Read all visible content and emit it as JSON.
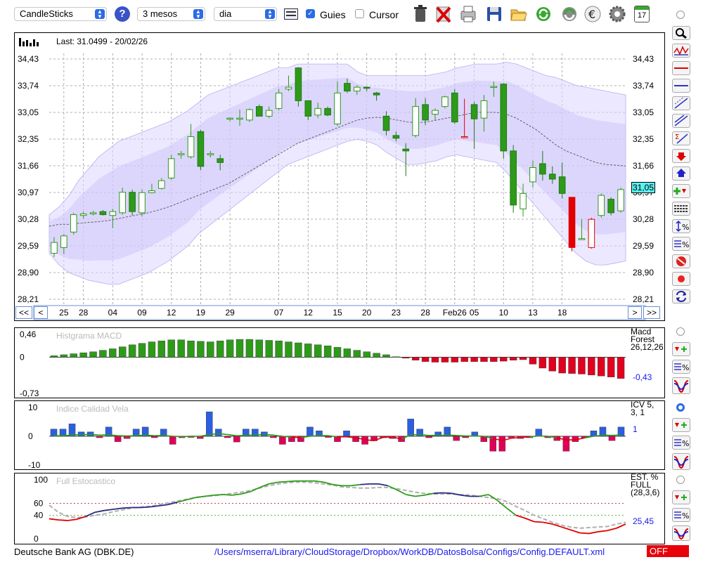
{
  "toolbar": {
    "chart_type": "CandleSticks",
    "help": "?",
    "period": "3 mesos",
    "interval": "dia",
    "guides_label": "Guies",
    "guides_checked": true,
    "cursor_label": "Cursor",
    "cursor_checked": false,
    "calendar_day": "17",
    "icons": [
      "chart-settings-icon",
      "trash-icon",
      "delete-icon",
      "print-icon",
      "save-icon",
      "open-folder-icon",
      "refresh-icon",
      "reload-icon",
      "euro-icon",
      "gear-icon",
      "calendar-icon"
    ]
  },
  "main_chart": {
    "last_label": "Last: 31.0499 - 20/02/26",
    "current_price": "31,05",
    "y_ticks": [
      "34,43",
      "33,74",
      "33,05",
      "32,35",
      "31,66",
      "30,97",
      "30,28",
      "29,59",
      "28,90",
      "28,21"
    ],
    "nav_prev_far": "<<",
    "nav_prev": "<",
    "nav_next": ">",
    "nav_next_far": ">>"
  },
  "chart_data": [
    {
      "type": "candlestick",
      "title": "",
      "ylim": [
        28.21,
        34.43
      ],
      "x_tick_labels": [
        "25",
        "28",
        "04",
        "09",
        "12",
        "19",
        "29",
        "07",
        "12",
        "15",
        "20",
        "23",
        "28",
        "Feb26",
        "05",
        "10",
        "13",
        "18"
      ],
      "x_tick_index": [
        1,
        3,
        6,
        9,
        12,
        15,
        18,
        23,
        26,
        29,
        32,
        35,
        38,
        41,
        43,
        46,
        49,
        52
      ],
      "candles": [
        {
          "o": 29.4,
          "h": 29.82,
          "l": 29.3,
          "c": 29.68
        },
        {
          "o": 29.55,
          "h": 29.9,
          "l": 29.38,
          "c": 29.85
        },
        {
          "o": 29.95,
          "h": 30.45,
          "l": 29.88,
          "c": 30.4
        },
        {
          "o": 30.38,
          "h": 30.48,
          "l": 30.3,
          "c": 30.42
        },
        {
          "o": 30.42,
          "h": 30.5,
          "l": 30.38,
          "c": 30.45
        },
        {
          "o": 30.48,
          "h": 30.52,
          "l": 30.38,
          "c": 30.4
        },
        {
          "o": 30.38,
          "h": 30.55,
          "l": 30.05,
          "c": 30.48
        },
        {
          "o": 30.45,
          "h": 31.1,
          "l": 30.4,
          "c": 30.98
        },
        {
          "o": 30.98,
          "h": 31.05,
          "l": 30.38,
          "c": 30.48
        },
        {
          "o": 30.45,
          "h": 31.05,
          "l": 30.35,
          "c": 30.97
        },
        {
          "o": 30.97,
          "h": 31.2,
          "l": 30.95,
          "c": 31.02
        },
        {
          "o": 31.08,
          "h": 31.35,
          "l": 31.05,
          "c": 31.28
        },
        {
          "o": 31.35,
          "h": 31.95,
          "l": 31.3,
          "c": 31.85
        },
        {
          "o": 31.95,
          "h": 32.05,
          "l": 31.85,
          "c": 31.98
        },
        {
          "o": 31.9,
          "h": 32.75,
          "l": 31.85,
          "c": 32.42
        },
        {
          "o": 32.55,
          "h": 32.6,
          "l": 31.55,
          "c": 31.65
        },
        {
          "o": 31.95,
          "h": 32.05,
          "l": 31.88,
          "c": 31.98
        },
        {
          "o": 31.85,
          "h": 31.95,
          "l": 31.55,
          "c": 31.75
        },
        {
          "o": 32.88,
          "h": 32.92,
          "l": 32.82,
          "c": 32.9
        },
        {
          "o": 32.88,
          "h": 33.12,
          "l": 32.7,
          "c": 32.9
        },
        {
          "o": 32.85,
          "h": 33.15,
          "l": 32.8,
          "c": 33.12
        },
        {
          "o": 33.2,
          "h": 33.25,
          "l": 32.95,
          "c": 32.95
        },
        {
          "o": 32.95,
          "h": 33.2,
          "l": 32.9,
          "c": 33.1
        },
        {
          "o": 33.15,
          "h": 33.65,
          "l": 33.1,
          "c": 33.55
        },
        {
          "o": 33.65,
          "h": 34.0,
          "l": 33.6,
          "c": 33.7
        },
        {
          "o": 34.2,
          "h": 34.22,
          "l": 33.2,
          "c": 33.35
        },
        {
          "o": 33.35,
          "h": 33.35,
          "l": 32.85,
          "c": 32.95
        },
        {
          "o": 32.98,
          "h": 33.3,
          "l": 32.9,
          "c": 33.15
        },
        {
          "o": 33.15,
          "h": 33.2,
          "l": 32.95,
          "c": 32.98
        },
        {
          "o": 32.75,
          "h": 33.85,
          "l": 32.7,
          "c": 33.55
        },
        {
          "o": 33.8,
          "h": 33.92,
          "l": 33.55,
          "c": 33.6
        },
        {
          "o": 33.6,
          "h": 33.75,
          "l": 33.5,
          "c": 33.7
        },
        {
          "o": 33.7,
          "h": 33.72,
          "l": 33.6,
          "c": 33.68
        },
        {
          "o": 33.55,
          "h": 33.58,
          "l": 33.35,
          "c": 33.5
        },
        {
          "o": 32.95,
          "h": 33.08,
          "l": 32.45,
          "c": 32.58
        },
        {
          "o": 32.45,
          "h": 32.55,
          "l": 32.3,
          "c": 32.38
        },
        {
          "o": 32.1,
          "h": 32.25,
          "l": 31.4,
          "c": 32.05
        },
        {
          "o": 32.45,
          "h": 33.42,
          "l": 32.4,
          "c": 33.2
        },
        {
          "o": 33.25,
          "h": 33.42,
          "l": 32.72,
          "c": 32.85
        },
        {
          "o": 33.0,
          "h": 33.15,
          "l": 32.85,
          "c": 33.1
        },
        {
          "o": 33.2,
          "h": 33.48,
          "l": 33.15,
          "c": 33.45
        },
        {
          "o": 33.55,
          "h": 33.65,
          "l": 32.75,
          "c": 32.8
        },
        {
          "o": 32.42,
          "h": 33.4,
          "l": 32.38,
          "c": 32.4
        },
        {
          "o": 33.25,
          "h": 33.32,
          "l": 32.1,
          "c": 32.88
        },
        {
          "o": 32.9,
          "h": 33.5,
          "l": 32.55,
          "c": 33.35
        },
        {
          "o": 33.7,
          "h": 33.85,
          "l": 33.45,
          "c": 33.72
        },
        {
          "o": 33.78,
          "h": 33.8,
          "l": 31.85,
          "c": 32.05
        },
        {
          "o": 32.05,
          "h": 32.2,
          "l": 30.45,
          "c": 30.65
        },
        {
          "o": 30.55,
          "h": 31.2,
          "l": 30.35,
          "c": 30.95
        },
        {
          "o": 31.25,
          "h": 31.8,
          "l": 31.1,
          "c": 31.62
        },
        {
          "o": 31.72,
          "h": 32.05,
          "l": 31.28,
          "c": 31.45
        },
        {
          "o": 31.45,
          "h": 31.65,
          "l": 31.2,
          "c": 31.32
        },
        {
          "o": 31.38,
          "h": 31.75,
          "l": 30.82,
          "c": 30.95
        },
        {
          "o": 30.85,
          "h": 30.85,
          "l": 29.45,
          "c": 29.55
        },
        {
          "o": 29.78,
          "h": 30.28,
          "l": 29.75,
          "c": 29.78
        },
        {
          "o": 30.28,
          "h": 30.32,
          "l": 29.52,
          "c": 29.55
        },
        {
          "o": 30.38,
          "h": 30.95,
          "l": 30.32,
          "c": 30.9
        },
        {
          "o": 30.8,
          "h": 30.85,
          "l": 30.38,
          "c": 30.45
        },
        {
          "o": 30.5,
          "h": 31.1,
          "l": 30.45,
          "c": 31.05
        }
      ],
      "bollinger_upper": [
        30.4,
        30.6,
        30.9,
        31.3,
        31.6,
        31.9,
        32.1,
        32.3,
        32.4,
        32.5,
        32.6,
        32.7,
        32.8,
        32.95,
        33.1,
        33.3,
        33.5,
        33.6,
        33.7,
        33.8,
        33.9,
        34.0,
        34.1,
        34.2,
        34.2,
        34.3,
        34.3,
        34.3,
        34.3,
        34.3,
        34.3,
        34.1,
        34.0,
        34.0,
        34.0,
        34.0,
        34.0,
        34.0,
        34.0,
        34.05,
        34.1,
        34.2,
        34.25,
        34.3,
        34.3,
        34.3,
        34.35,
        34.3,
        34.2,
        34.1,
        34.0,
        33.95,
        33.85,
        33.75,
        33.7,
        33.65,
        33.6,
        33.55,
        33.5
      ],
      "bollinger_lower": [
        29.4,
        29.1,
        28.9,
        28.8,
        28.7,
        28.65,
        28.6,
        28.6,
        28.7,
        28.8,
        28.9,
        29.05,
        29.2,
        29.4,
        29.6,
        29.9,
        30.1,
        30.3,
        30.5,
        30.7,
        30.9,
        31.1,
        31.3,
        31.5,
        31.7,
        31.8,
        31.9,
        32.0,
        32.1,
        32.2,
        32.3,
        32.35,
        32.3,
        32.2,
        32.0,
        31.85,
        31.7,
        31.7,
        31.75,
        31.8,
        31.9,
        31.95,
        31.9,
        31.85,
        31.8,
        31.75,
        31.5,
        31.2,
        30.9,
        30.6,
        30.3,
        30.0,
        29.7,
        29.4,
        29.2,
        29.1,
        29.1,
        29.15,
        29.2
      ],
      "moving_average": [
        30.1,
        30.15,
        30.15,
        30.18,
        30.2,
        30.22,
        30.25,
        30.3,
        30.35,
        30.4,
        30.45,
        30.52,
        30.6,
        30.7,
        30.8,
        30.9,
        31.0,
        31.1,
        31.2,
        31.35,
        31.5,
        31.65,
        31.8,
        31.95,
        32.1,
        32.25,
        32.35,
        32.45,
        32.55,
        32.65,
        32.75,
        32.85,
        32.9,
        32.92,
        32.9,
        32.85,
        32.8,
        32.78,
        32.8,
        32.85,
        32.9,
        32.95,
        33.0,
        33.05,
        33.05,
        33.05,
        33.0,
        32.9,
        32.75,
        32.6,
        32.4,
        32.2,
        32.05,
        31.95,
        31.85,
        31.75,
        31.7,
        31.68,
        31.66
      ]
    },
    {
      "type": "bar",
      "title": "Histgrama MACD",
      "params_label": "Macd Forest 26,12,26",
      "current_value": "-0,43",
      "y_ticks": [
        "0,46",
        "0",
        "-0,73"
      ],
      "ylim": [
        -0.73,
        0.46
      ],
      "values": [
        0.03,
        0.05,
        0.07,
        0.09,
        0.11,
        0.14,
        0.17,
        0.21,
        0.25,
        0.28,
        0.31,
        0.33,
        0.35,
        0.35,
        0.33,
        0.32,
        0.31,
        0.33,
        0.35,
        0.36,
        0.36,
        0.35,
        0.34,
        0.33,
        0.31,
        0.29,
        0.27,
        0.25,
        0.23,
        0.2,
        0.17,
        0.14,
        0.11,
        0.08,
        0.05,
        0.01,
        -0.02,
        -0.06,
        -0.09,
        -0.1,
        -0.1,
        -0.1,
        -0.09,
        -0.09,
        -0.09,
        -0.09,
        -0.08,
        -0.06,
        -0.05,
        -0.14,
        -0.22,
        -0.28,
        -0.32,
        -0.33,
        -0.34,
        -0.36,
        -0.38,
        -0.4,
        -0.43
      ]
    },
    {
      "type": "bar",
      "title": "Indice Calidad Vela",
      "params_label": "ICV 5, 3, 1",
      "current_value": "1",
      "y_ticks": [
        "10",
        "0",
        "-10"
      ],
      "ylim": [
        -10,
        10
      ],
      "values": [
        2.5,
        2.5,
        4.3,
        1.5,
        1.5,
        -0.5,
        3.2,
        -1.9,
        -0.8,
        2.5,
        3.2,
        -0.5,
        2.5,
        -2.8,
        -0.5,
        -0.4,
        -0.8,
        8.5,
        2.5,
        -0.5,
        -2,
        2.5,
        2.5,
        1.5,
        -0.5,
        -2.8,
        -1.9,
        -1.9,
        3.2,
        1.9,
        -0.4,
        -1.9,
        1.9,
        -1.9,
        -2.8,
        -1.6,
        -0.5,
        -0.8,
        -1.9,
        6.0,
        2.5,
        -0.5,
        1.5,
        3.2,
        -1.5,
        -0.5,
        1.5,
        -1.9,
        -5.2,
        -5.2,
        -0.5,
        -0.8,
        -0.5,
        2.5,
        -0.5,
        -1.5,
        -5.2,
        -1.9,
        -0.5,
        1.9,
        3.2,
        -1.5,
        3.2
      ],
      "line": [
        0.2,
        0.2,
        0.4,
        0.6,
        0.6,
        0.4,
        0.5,
        0.2,
        0.1,
        0.2,
        0.4,
        0.2,
        0.3,
        0.0,
        -0.1,
        0.0,
        0.0,
        0.6,
        0.9,
        0.6,
        0.2,
        0.3,
        0.5,
        0.6,
        0.4,
        0.0,
        -0.3,
        -0.5,
        0.0,
        0.3,
        0.2,
        -0.2,
        -0.2,
        -0.5,
        -1.2,
        -1.5,
        -0.4,
        -0.2,
        -1.0,
        0.5,
        0.6,
        0.3,
        0.3,
        0.4,
        0.3,
        0.1,
        0.1,
        0.0,
        -0.8,
        -1.5,
        -0.7,
        -0.4,
        -0.2,
        0.1,
        0.0,
        -0.5,
        -1.3,
        -1.2,
        -0.6,
        0.0,
        0.4,
        0.3,
        0.5
      ]
    },
    {
      "type": "line",
      "title": "Full Estocastico",
      "params_label": "EST. % FULL (28,3,6)",
      "current_value": "25,45",
      "y_ticks": [
        "100",
        "60",
        "40",
        "0"
      ],
      "ylim": [
        0,
        100
      ],
      "series": [
        {
          "values": [
            34,
            32,
            31,
            33,
            38,
            45,
            48,
            50,
            52,
            53,
            53,
            54,
            56,
            58,
            62,
            66,
            70,
            72,
            74,
            75,
            74,
            76,
            80,
            87,
            93,
            96,
            97,
            98,
            98,
            98,
            96,
            92,
            90,
            90,
            92,
            93,
            93,
            90,
            83,
            75,
            72,
            74,
            77,
            78,
            77,
            74,
            72,
            72,
            75,
            65,
            52,
            40,
            35,
            29,
            28,
            25,
            20,
            15,
            10,
            9,
            12,
            14,
            18,
            25
          ]
        },
        {
          "values": [
            57,
            45,
            38,
            36,
            37,
            40,
            42,
            46,
            49,
            52,
            54,
            55,
            58,
            61,
            64,
            67,
            70,
            72,
            73,
            75,
            77,
            79,
            82,
            86,
            90,
            93,
            95,
            96,
            96,
            95,
            93,
            91,
            88,
            87,
            86,
            86,
            87,
            87,
            85,
            82,
            79,
            77,
            76,
            76,
            76,
            75,
            74,
            72,
            70,
            68,
            63,
            55,
            48,
            40,
            34,
            28,
            23,
            20,
            18,
            19,
            20,
            21,
            25,
            28
          ]
        }
      ],
      "reference_lines": [
        60,
        40
      ]
    }
  ],
  "right_toolbar": {
    "icons": [
      "zoom-icon",
      "bollinger-icon",
      "horizontal-line-red-icon",
      "horizontal-line-blue-icon",
      "trend-line-icon",
      "channel-icon",
      "fibonacci-icon",
      "sell-arrow-icon",
      "buy-arrow-icon",
      "add-signal-icon",
      "grid-lines-icon",
      "zoom-percent-icon",
      "percent-icon",
      "stop-icon",
      "record-icon",
      "swap-icon"
    ],
    "indicator_icons": [
      "signal-arrows-icon",
      "percent-lines-icon",
      "stochastic-curve-icon"
    ]
  },
  "footer": {
    "company": "Deutsche Bank AG (DBK.DE)",
    "config_path": "/Users/mserra/Library/CloudStorage/Dropbox/WorkDB/DatosBolsa/Configs/Config.DEFAULT.xml",
    "status": "OFF"
  },
  "colors": {
    "up_candle": "#ffffff",
    "down_candle": "#2e9a1a",
    "alert_candle": "#e00000",
    "band": "#dcd6ff",
    "macd_pos": "#2e9a1a",
    "macd_neg": "#e00020",
    "icv_pos": "#2b5fe0",
    "icv_neg": "#e0005a",
    "sto_k": "#e00000",
    "sto_d": "#b0b0b0"
  }
}
